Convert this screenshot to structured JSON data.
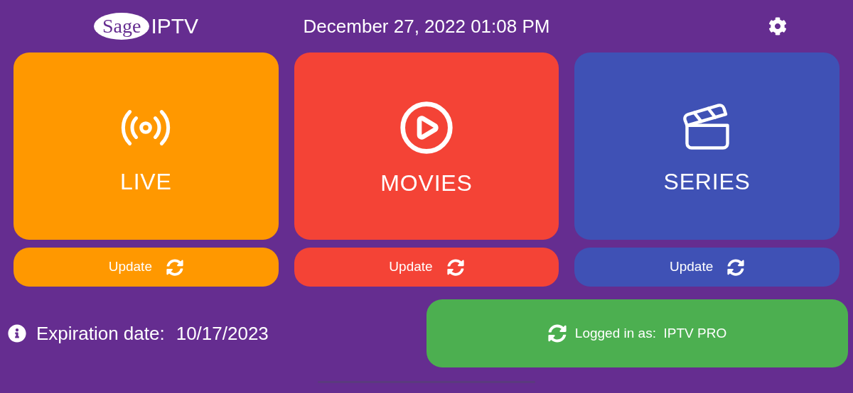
{
  "logo": {
    "word_1": "Sage",
    "word_2": "IPTV"
  },
  "datetime": "December 27, 2022 01:08 PM",
  "tiles": [
    {
      "kind": "live",
      "label": "LIVE",
      "color": "#ff9800",
      "update": "Update"
    },
    {
      "kind": "movies",
      "label": "MOVIES",
      "color": "#f44336",
      "update": "Update"
    },
    {
      "kind": "series",
      "label": "SERIES",
      "color": "#3f51b5",
      "update": "Update"
    }
  ],
  "expiration": {
    "label": "Expiration date:",
    "value": "10/17/2023"
  },
  "login_button": {
    "label": "Logged in as:",
    "user": "IPTV PRO"
  }
}
